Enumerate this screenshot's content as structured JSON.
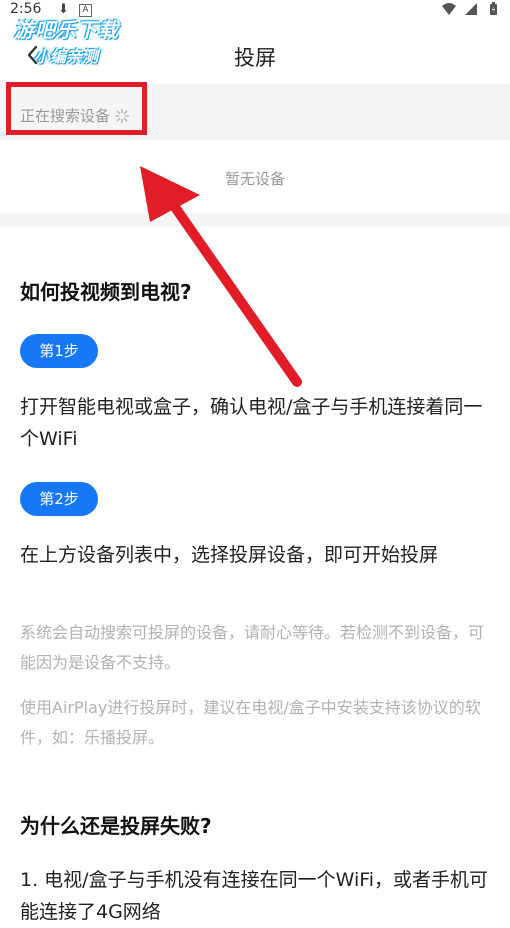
{
  "status_bar": {
    "time": "2:56",
    "left_icons": [
      "download-icon",
      "a-icon"
    ],
    "right_icons": [
      "wifi-icon",
      "signal-icon",
      "battery-charging-icon"
    ]
  },
  "watermark": {
    "line1": "游吧乐下载",
    "line2": "小编亲测"
  },
  "header": {
    "title": "投屏",
    "back_icon": "chevron-left-icon"
  },
  "device_search": {
    "status": "正在搜索设备",
    "spinner_icon": "spinner-icon",
    "empty_text": "暂无设备"
  },
  "annotation": {
    "highlight_color": "#e31d27",
    "arrow_color": "#e31d27"
  },
  "help": {
    "title": "如何投视频到电视?",
    "steps": [
      {
        "badge": "第1步",
        "text": "打开智能电视或盒子，确认电视/盒子与手机连接着同一个WiFi"
      },
      {
        "badge": "第2步",
        "text": "在上方设备列表中，选择投屏设备，即可开始投屏"
      }
    ],
    "notes": [
      "系统会自动搜索可投屏的设备，请耐心等待。若检测不到设备，可能因为是设备不支持。",
      "使用AirPlay进行投屏时，建议在电视/盒子中安装支持该协议的软件，如：乐播投屏。"
    ]
  },
  "failure": {
    "title": "为什么还是投屏失败?",
    "reasons": [
      "1. 电视/盒子与手机没有连接在同一个WiFi，或者手机可能连接了4G网络"
    ]
  },
  "colors": {
    "accent": "#1678f4",
    "muted_text": "#999999",
    "section_bg": "#f4f5f7"
  }
}
